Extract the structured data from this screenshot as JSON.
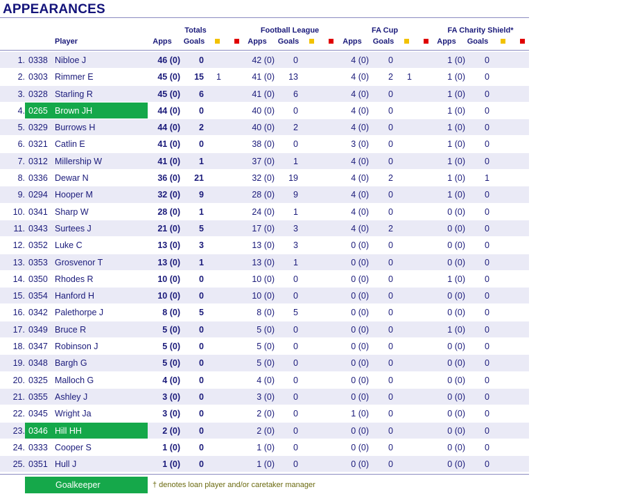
{
  "title": "APPEARANCES",
  "headers": {
    "player": "Player",
    "totals": "Totals",
    "football_league": "Football League",
    "fa_cup": "FA Cup",
    "charity_shield": "FA Charity Shield*",
    "apps": "Apps",
    "goals": "Goals"
  },
  "colors": {
    "goalkeeper": "#15a84a",
    "yellow_card": "#f2c200",
    "red_card": "#e00000",
    "alt_row": "#eaeaf6"
  },
  "legend": {
    "goalkeeper": "Goalkeeper",
    "note": "† denotes loan player and/or caretaker manager"
  },
  "rows": [
    {
      "n": "1.",
      "code": "0338",
      "name": "Nibloe J",
      "gk": false,
      "t_apps": "46 (0)",
      "t_goals": "0",
      "t_y": "",
      "fl_apps": "42 (0)",
      "fl_goals": "0",
      "fc_apps": "4 (0)",
      "fc_goals": "0",
      "fc_y": "",
      "cs_apps": "1 (0)",
      "cs_goals": "0"
    },
    {
      "n": "2.",
      "code": "0303",
      "name": "Rimmer E",
      "gk": false,
      "t_apps": "45 (0)",
      "t_goals": "15",
      "t_y": "1",
      "fl_apps": "41 (0)",
      "fl_goals": "13",
      "fc_apps": "4 (0)",
      "fc_goals": "2",
      "fc_y": "1",
      "cs_apps": "1 (0)",
      "cs_goals": "0"
    },
    {
      "n": "3.",
      "code": "0328",
      "name": "Starling R",
      "gk": false,
      "t_apps": "45 (0)",
      "t_goals": "6",
      "t_y": "",
      "fl_apps": "41 (0)",
      "fl_goals": "6",
      "fc_apps": "4 (0)",
      "fc_goals": "0",
      "fc_y": "",
      "cs_apps": "1 (0)",
      "cs_goals": "0"
    },
    {
      "n": "4.",
      "code": "0265",
      "name": "Brown JH",
      "gk": true,
      "t_apps": "44 (0)",
      "t_goals": "0",
      "t_y": "",
      "fl_apps": "40 (0)",
      "fl_goals": "0",
      "fc_apps": "4 (0)",
      "fc_goals": "0",
      "fc_y": "",
      "cs_apps": "1 (0)",
      "cs_goals": "0"
    },
    {
      "n": "5.",
      "code": "0329",
      "name": "Burrows H",
      "gk": false,
      "t_apps": "44 (0)",
      "t_goals": "2",
      "t_y": "",
      "fl_apps": "40 (0)",
      "fl_goals": "2",
      "fc_apps": "4 (0)",
      "fc_goals": "0",
      "fc_y": "",
      "cs_apps": "1 (0)",
      "cs_goals": "0"
    },
    {
      "n": "6.",
      "code": "0321",
      "name": "Catlin E",
      "gk": false,
      "t_apps": "41 (0)",
      "t_goals": "0",
      "t_y": "",
      "fl_apps": "38 (0)",
      "fl_goals": "0",
      "fc_apps": "3 (0)",
      "fc_goals": "0",
      "fc_y": "",
      "cs_apps": "1 (0)",
      "cs_goals": "0"
    },
    {
      "n": "7.",
      "code": "0312",
      "name": "Millership W",
      "gk": false,
      "t_apps": "41 (0)",
      "t_goals": "1",
      "t_y": "",
      "fl_apps": "37 (0)",
      "fl_goals": "1",
      "fc_apps": "4 (0)",
      "fc_goals": "0",
      "fc_y": "",
      "cs_apps": "1 (0)",
      "cs_goals": "0"
    },
    {
      "n": "8.",
      "code": "0336",
      "name": "Dewar N",
      "gk": false,
      "t_apps": "36 (0)",
      "t_goals": "21",
      "t_y": "",
      "fl_apps": "32 (0)",
      "fl_goals": "19",
      "fc_apps": "4 (0)",
      "fc_goals": "2",
      "fc_y": "",
      "cs_apps": "1 (0)",
      "cs_goals": "1"
    },
    {
      "n": "9.",
      "code": "0294",
      "name": "Hooper M",
      "gk": false,
      "t_apps": "32 (0)",
      "t_goals": "9",
      "t_y": "",
      "fl_apps": "28 (0)",
      "fl_goals": "9",
      "fc_apps": "4 (0)",
      "fc_goals": "0",
      "fc_y": "",
      "cs_apps": "1 (0)",
      "cs_goals": "0"
    },
    {
      "n": "10.",
      "code": "0341",
      "name": "Sharp W",
      "gk": false,
      "t_apps": "28 (0)",
      "t_goals": "1",
      "t_y": "",
      "fl_apps": "24 (0)",
      "fl_goals": "1",
      "fc_apps": "4 (0)",
      "fc_goals": "0",
      "fc_y": "",
      "cs_apps": "0 (0)",
      "cs_goals": "0"
    },
    {
      "n": "11.",
      "code": "0343",
      "name": "Surtees J",
      "gk": false,
      "t_apps": "21 (0)",
      "t_goals": "5",
      "t_y": "",
      "fl_apps": "17 (0)",
      "fl_goals": "3",
      "fc_apps": "4 (0)",
      "fc_goals": "2",
      "fc_y": "",
      "cs_apps": "0 (0)",
      "cs_goals": "0"
    },
    {
      "n": "12.",
      "code": "0352",
      "name": "Luke C",
      "gk": false,
      "t_apps": "13 (0)",
      "t_goals": "3",
      "t_y": "",
      "fl_apps": "13 (0)",
      "fl_goals": "3",
      "fc_apps": "0 (0)",
      "fc_goals": "0",
      "fc_y": "",
      "cs_apps": "0 (0)",
      "cs_goals": "0"
    },
    {
      "n": "13.",
      "code": "0353",
      "name": "Grosvenor T",
      "gk": false,
      "t_apps": "13 (0)",
      "t_goals": "1",
      "t_y": "",
      "fl_apps": "13 (0)",
      "fl_goals": "1",
      "fc_apps": "0 (0)",
      "fc_goals": "0",
      "fc_y": "",
      "cs_apps": "0 (0)",
      "cs_goals": "0"
    },
    {
      "n": "14.",
      "code": "0350",
      "name": "Rhodes R",
      "gk": false,
      "t_apps": "10 (0)",
      "t_goals": "0",
      "t_y": "",
      "fl_apps": "10 (0)",
      "fl_goals": "0",
      "fc_apps": "0 (0)",
      "fc_goals": "0",
      "fc_y": "",
      "cs_apps": "1 (0)",
      "cs_goals": "0"
    },
    {
      "n": "15.",
      "code": "0354",
      "name": "Hanford H",
      "gk": false,
      "t_apps": "10 (0)",
      "t_goals": "0",
      "t_y": "",
      "fl_apps": "10 (0)",
      "fl_goals": "0",
      "fc_apps": "0 (0)",
      "fc_goals": "0",
      "fc_y": "",
      "cs_apps": "0 (0)",
      "cs_goals": "0"
    },
    {
      "n": "16.",
      "code": "0342",
      "name": "Palethorpe J",
      "gk": false,
      "t_apps": "8 (0)",
      "t_goals": "5",
      "t_y": "",
      "fl_apps": "8 (0)",
      "fl_goals": "5",
      "fc_apps": "0 (0)",
      "fc_goals": "0",
      "fc_y": "",
      "cs_apps": "0 (0)",
      "cs_goals": "0"
    },
    {
      "n": "17.",
      "code": "0349",
      "name": "Bruce R",
      "gk": false,
      "t_apps": "5 (0)",
      "t_goals": "0",
      "t_y": "",
      "fl_apps": "5 (0)",
      "fl_goals": "0",
      "fc_apps": "0 (0)",
      "fc_goals": "0",
      "fc_y": "",
      "cs_apps": "1 (0)",
      "cs_goals": "0"
    },
    {
      "n": "18.",
      "code": "0347",
      "name": "Robinson J",
      "gk": false,
      "t_apps": "5 (0)",
      "t_goals": "0",
      "t_y": "",
      "fl_apps": "5 (0)",
      "fl_goals": "0",
      "fc_apps": "0 (0)",
      "fc_goals": "0",
      "fc_y": "",
      "cs_apps": "0 (0)",
      "cs_goals": "0"
    },
    {
      "n": "19.",
      "code": "0348",
      "name": "Bargh G",
      "gk": false,
      "t_apps": "5 (0)",
      "t_goals": "0",
      "t_y": "",
      "fl_apps": "5 (0)",
      "fl_goals": "0",
      "fc_apps": "0 (0)",
      "fc_goals": "0",
      "fc_y": "",
      "cs_apps": "0 (0)",
      "cs_goals": "0"
    },
    {
      "n": "20.",
      "code": "0325",
      "name": "Malloch G",
      "gk": false,
      "t_apps": "4 (0)",
      "t_goals": "0",
      "t_y": "",
      "fl_apps": "4 (0)",
      "fl_goals": "0",
      "fc_apps": "0 (0)",
      "fc_goals": "0",
      "fc_y": "",
      "cs_apps": "0 (0)",
      "cs_goals": "0"
    },
    {
      "n": "21.",
      "code": "0355",
      "name": "Ashley J",
      "gk": false,
      "t_apps": "3 (0)",
      "t_goals": "0",
      "t_y": "",
      "fl_apps": "3 (0)",
      "fl_goals": "0",
      "fc_apps": "0 (0)",
      "fc_goals": "0",
      "fc_y": "",
      "cs_apps": "0 (0)",
      "cs_goals": "0"
    },
    {
      "n": "22.",
      "code": "0345",
      "name": "Wright Ja",
      "gk": false,
      "t_apps": "3 (0)",
      "t_goals": "0",
      "t_y": "",
      "fl_apps": "2 (0)",
      "fl_goals": "0",
      "fc_apps": "1 (0)",
      "fc_goals": "0",
      "fc_y": "",
      "cs_apps": "0 (0)",
      "cs_goals": "0"
    },
    {
      "n": "23.",
      "code": "0346",
      "name": "Hill HH",
      "gk": true,
      "t_apps": "2 (0)",
      "t_goals": "0",
      "t_y": "",
      "fl_apps": "2 (0)",
      "fl_goals": "0",
      "fc_apps": "0 (0)",
      "fc_goals": "0",
      "fc_y": "",
      "cs_apps": "0 (0)",
      "cs_goals": "0"
    },
    {
      "n": "24.",
      "code": "0333",
      "name": "Cooper S",
      "gk": false,
      "t_apps": "1 (0)",
      "t_goals": "0",
      "t_y": "",
      "fl_apps": "1 (0)",
      "fl_goals": "0",
      "fc_apps": "0 (0)",
      "fc_goals": "0",
      "fc_y": "",
      "cs_apps": "0 (0)",
      "cs_goals": "0"
    },
    {
      "n": "25.",
      "code": "0351",
      "name": "Hull J",
      "gk": false,
      "t_apps": "1 (0)",
      "t_goals": "0",
      "t_y": "",
      "fl_apps": "1 (0)",
      "fl_goals": "0",
      "fc_apps": "0 (0)",
      "fc_goals": "0",
      "fc_y": "",
      "cs_apps": "0 (0)",
      "cs_goals": "0"
    }
  ]
}
